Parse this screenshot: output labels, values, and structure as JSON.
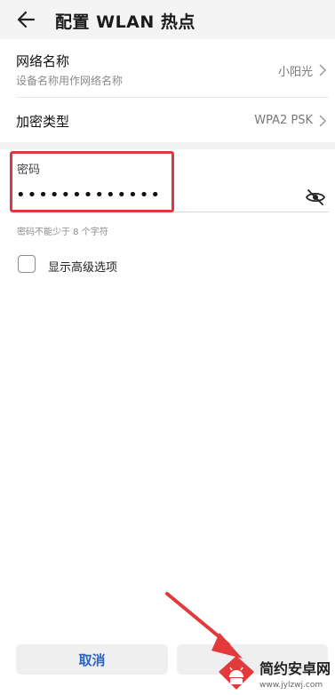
{
  "header": {
    "title": "配置 WLAN 热点"
  },
  "settings": {
    "network_name": {
      "label": "网络名称",
      "hint": "设备名称用作网络名称",
      "value": "小阳光"
    },
    "encryption": {
      "label": "加密类型",
      "value": "WPA2 PSK"
    },
    "password": {
      "label": "密码",
      "value": "•••••••••••••",
      "hint": "密码不能少于 8 个字符"
    },
    "advanced": {
      "label": "显示高级选项",
      "checked": false
    }
  },
  "footer": {
    "cancel_label": "取消"
  },
  "watermark": {
    "title": "简约安卓网",
    "url": "www.jylzwj.com"
  },
  "colors": {
    "accent": "#2b63c4",
    "highlight": "#e23a3a"
  }
}
